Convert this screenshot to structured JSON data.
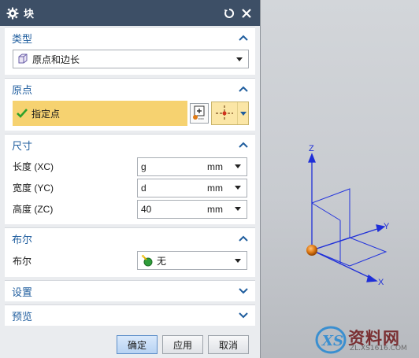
{
  "titlebar": {
    "title": "块",
    "icons": {
      "settings": "gear-icon",
      "reset": "reset-icon",
      "close": "close-icon"
    }
  },
  "groups": {
    "type": {
      "title": "类型",
      "value": "原点和边长"
    },
    "origin": {
      "title": "原点",
      "point_label": "指定点"
    },
    "dimensions": {
      "title": "尺寸",
      "length": {
        "label": "长度 (XC)",
        "value": "g",
        "unit": "mm"
      },
      "width": {
        "label": "宽度 (YC)",
        "value": "d",
        "unit": "mm"
      },
      "height": {
        "label": "高度 (ZC)",
        "value": "40",
        "unit": "mm"
      }
    },
    "boolean": {
      "title": "布尔",
      "label": "布尔",
      "value": "无"
    },
    "settings": {
      "title": "设置"
    },
    "preview": {
      "title": "预览"
    }
  },
  "footer": {
    "ok": "确定",
    "apply": "应用",
    "cancel": "取消"
  },
  "viewport": {
    "axes": {
      "x": "X",
      "y": "Y",
      "z": "Z"
    }
  },
  "watermark": {
    "main": "资料网",
    "sub": "ZL.XS1616.COM"
  },
  "colors": {
    "titlebar": "#3d4f66",
    "section_title": "#1f5d9e",
    "highlight": "#f6d270",
    "axis_blue": "#1f2fd8",
    "origin_orange": "#e07a14"
  }
}
